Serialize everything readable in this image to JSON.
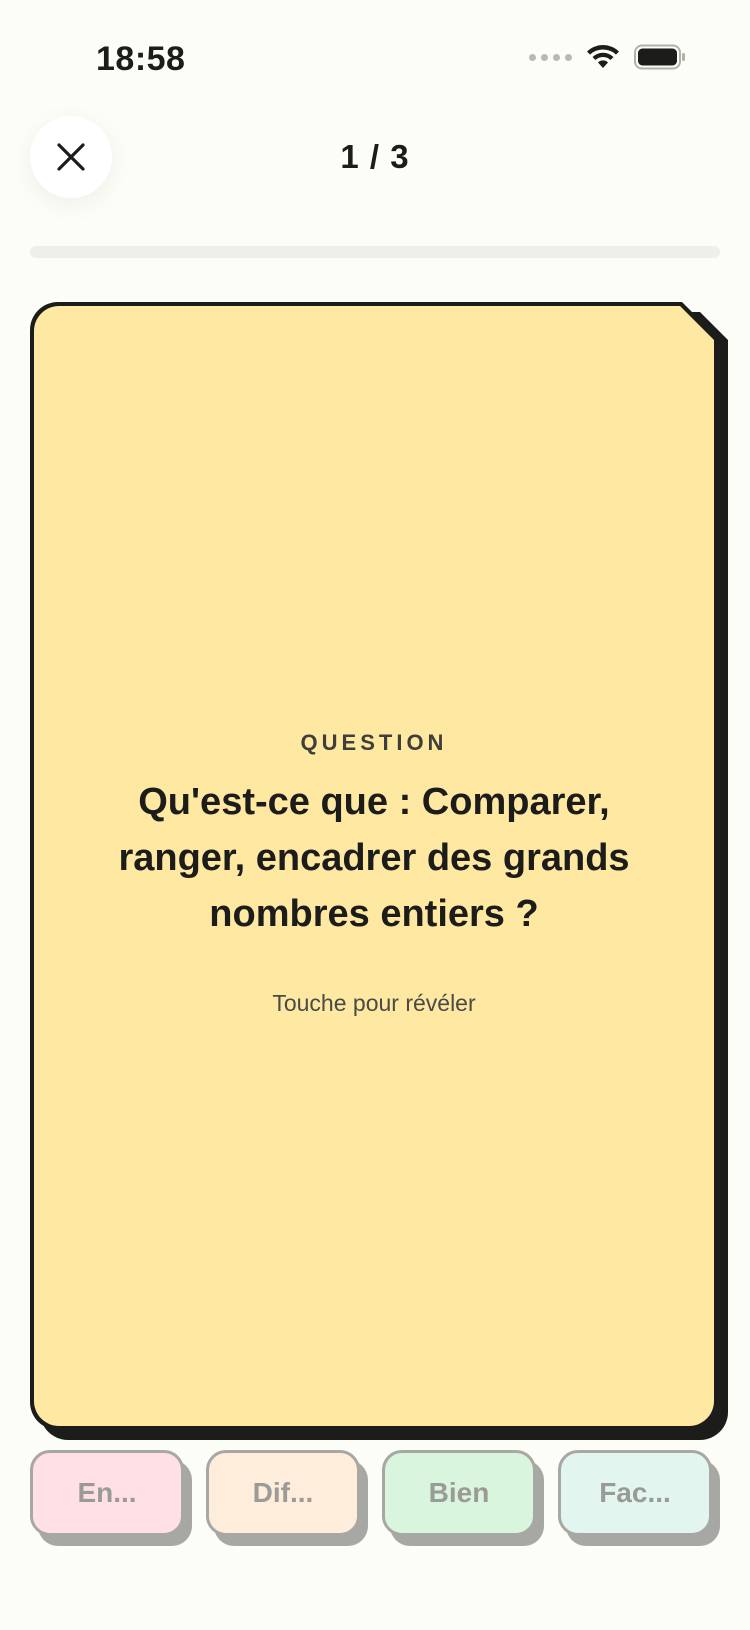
{
  "status_bar": {
    "time": "18:58",
    "icons": [
      "signal-dots-icon",
      "wifi-icon",
      "battery-icon"
    ]
  },
  "header": {
    "close_icon": "close-icon",
    "counter": "1 / 3",
    "progress": 0.0
  },
  "card": {
    "label": "QUESTION",
    "question": "Qu'est-ce que : Comparer, ranger, encadrer des grands nombres entiers ?",
    "hint": "Touche pour révéler",
    "color": "#fee8a2"
  },
  "ratings": [
    {
      "label": "En...",
      "color": "#ffe0e6"
    },
    {
      "label": "Dif...",
      "color": "#ffeddc"
    },
    {
      "label": "Bien",
      "color": "#d9f5dd"
    },
    {
      "label": "Fac...",
      "color": "#e2f5ee"
    }
  ]
}
